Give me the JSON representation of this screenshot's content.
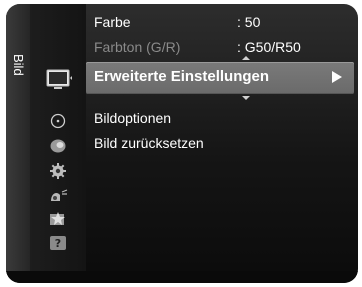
{
  "sidebar": {
    "section_label": "Bild"
  },
  "menu": {
    "items": [
      {
        "label": "Farbe",
        "value": ": 50"
      },
      {
        "label": "Farbton (G/R)",
        "value": ": G50/R50"
      },
      {
        "label": "Erweiterte Einstellungen"
      },
      {
        "label": "Bildoptionen"
      },
      {
        "label": "Bild zurücksetzen"
      }
    ]
  },
  "icons": [
    {
      "name": "picture-icon",
      "selected": true
    },
    {
      "name": "sound-icon"
    },
    {
      "name": "channel-icon"
    },
    {
      "name": "setup-icon"
    },
    {
      "name": "input-icon"
    },
    {
      "name": "application-icon"
    },
    {
      "name": "support-icon"
    }
  ],
  "colors": {
    "highlight": "#707070",
    "text": "#ffffff",
    "dim_text": "#8a8a8a"
  }
}
